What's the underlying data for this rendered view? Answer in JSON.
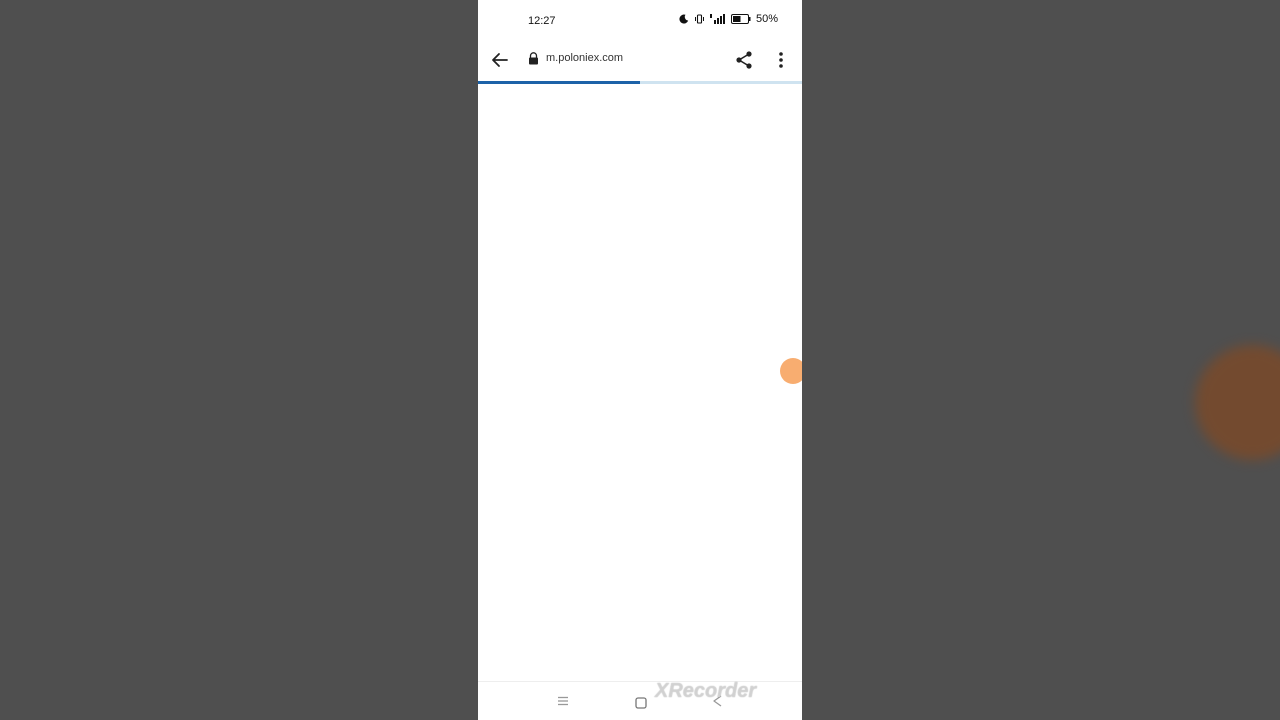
{
  "status_bar": {
    "time": "12:27",
    "battery_percent": "50%",
    "icons": [
      "moon-icon",
      "vibrate-icon",
      "signal-icon",
      "battery-icon"
    ]
  },
  "browser": {
    "url": "m.poloniex.com",
    "icons": [
      "back-arrow-icon",
      "lock-icon",
      "share-icon",
      "more-vert-icon"
    ],
    "load_progress_percent": 50,
    "accent_color": "#1c62a8"
  },
  "navigation_bar": {
    "icons": [
      "recents-icon",
      "home-icon",
      "back-icon"
    ]
  },
  "watermark": {
    "text": "XRecorder"
  }
}
